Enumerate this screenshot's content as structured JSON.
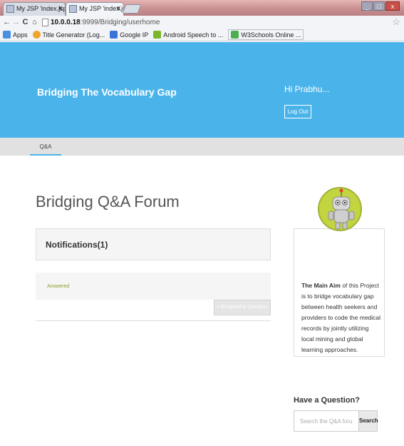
{
  "browser": {
    "tabs": [
      {
        "label": "My JSP 'index.jsp' starting",
        "active": false
      },
      {
        "label": "My JSP 'index.jsp' starting",
        "active": true
      }
    ],
    "window_buttons": {
      "minimize": "_",
      "maximize": "□",
      "close": "x"
    },
    "address": {
      "host": "10.0.0.18",
      "path": ":9999/Bridging/userhome"
    },
    "bookmarks": [
      {
        "label": "Apps",
        "icon": "apps-grid-icon",
        "color": "#4a8fe0"
      },
      {
        "label": "Title Generator (Log...",
        "icon": "title-generator-icon",
        "color": "#f0a62c"
      },
      {
        "label": "Google IP",
        "icon": "google-icon",
        "color": "#3b73d8"
      },
      {
        "label": "Android Speech to ...",
        "icon": "android-icon",
        "color": "#7ab829"
      },
      {
        "label": "W3Schools Online ...",
        "icon": "w3schools-icon",
        "color": "#4caf50"
      }
    ]
  },
  "header": {
    "brand": "Bridging The Vocabulary Gap",
    "greeting": "Hi Prabhu...",
    "logout_label": "Log Out",
    "bg_color": "#4ab4ea"
  },
  "subnav": {
    "tab_label": "Q&A"
  },
  "main": {
    "title": "Bridging Q&A Forum",
    "notifications_label": "Notifications(1)",
    "answered_label": "Answered",
    "respond_label": "+ Respond to Question"
  },
  "sidebar": {
    "aim_bold": "The Main Aim",
    "aim_text": " of this Project is to bridge vocabulary gap between health seekers and providers to code the medical records by jointly utilizing local mining and global learning approaches.",
    "ask_title": "Have a Question?",
    "search_placeholder": "Search the Q&A forum",
    "search_button": "Search"
  }
}
